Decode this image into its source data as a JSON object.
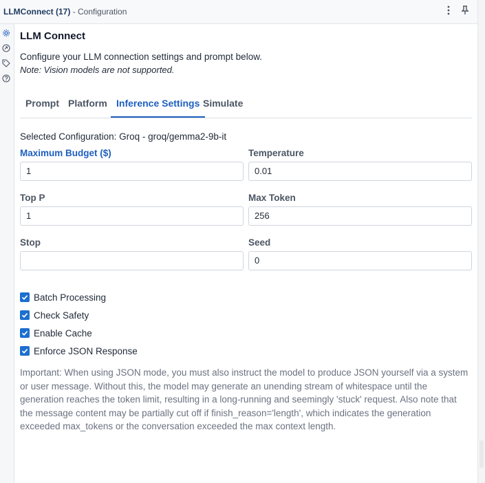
{
  "titlebar": {
    "app_name": "LLMConnect (17)",
    "subtitle": "- Configuration"
  },
  "header": {
    "title": "LLM Connect",
    "description": "Configure your LLM connection settings and prompt below.",
    "note": "Note: Vision models are not supported."
  },
  "tabs": [
    {
      "label": "Prompt"
    },
    {
      "label": "Platform"
    },
    {
      "label": "Inference Settings"
    },
    {
      "label": "Simulate"
    }
  ],
  "active_tab": "Inference Settings",
  "selected_configuration": "Selected Configuration: Groq - groq/gemma2-9b-it",
  "fields": {
    "max_budget": {
      "label": "Maximum Budget ($)",
      "value": "1"
    },
    "temperature": {
      "label": "Temperature",
      "value": "0.01"
    },
    "top_p": {
      "label": "Top P",
      "value": "1"
    },
    "max_token": {
      "label": "Max Token",
      "value": "256"
    },
    "stop": {
      "label": "Stop",
      "value": ""
    },
    "seed": {
      "label": "Seed",
      "value": "0"
    }
  },
  "checkboxes": [
    {
      "label": "Batch Processing",
      "checked": true
    },
    {
      "label": "Check Safety",
      "checked": true
    },
    {
      "label": "Enable Cache",
      "checked": true
    },
    {
      "label": "Enforce JSON Response",
      "checked": true
    }
  ],
  "important_text": "Important: When using JSON mode, you must also instruct the model to produce JSON yourself via a system or user message. Without this, the model may generate an unending stream of whitespace until the generation reaches the token limit, resulting in a long-running and seemingly 'stuck' request. Also note that the message content may be partially cut off if finish_reason='length', which indicates the generation exceeded max_tokens or the conversation exceeded the max context length.",
  "icons": {
    "title_menu": "kebab-menu-icon",
    "title_pin": "pin-icon",
    "rail": [
      "gear-icon",
      "connection-icon",
      "tag-icon",
      "help-icon"
    ]
  },
  "colors": {
    "accent": "#1d5fbf",
    "checkbox": "#1d6fd0",
    "muted_text": "#6b7280"
  }
}
